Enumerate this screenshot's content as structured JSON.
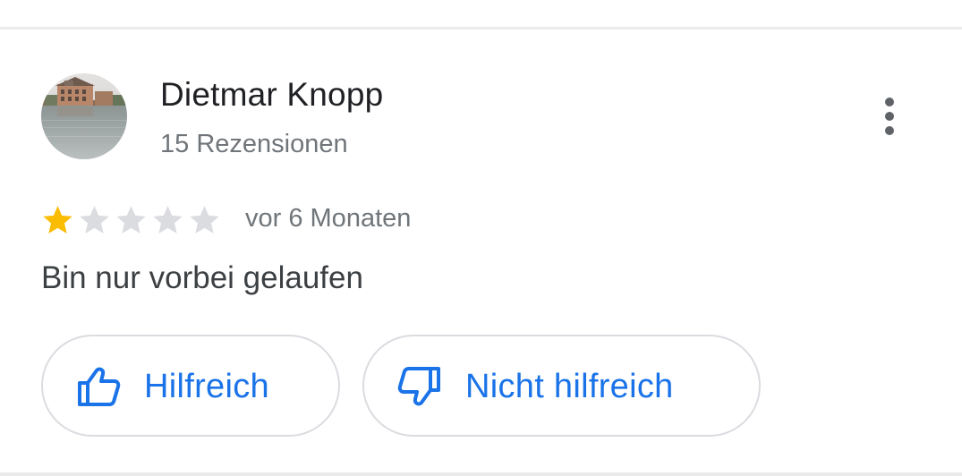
{
  "review": {
    "reviewer_name": "Dietmar Knopp",
    "review_count": "15 Rezensionen",
    "rating": 1,
    "max_rating": 5,
    "time_ago": "vor 6 Monaten",
    "text": "Bin nur vorbei gelaufen"
  },
  "actions": {
    "helpful_label": "Hilfreich",
    "helpful_icon": "thumb-up-icon",
    "not_helpful_label": "Nicht hilfreich",
    "not_helpful_icon": "thumb-down-icon",
    "more_icon": "more-vert-icon"
  },
  "colors": {
    "star_filled": "#fbbc04",
    "star_empty": "#dadce0",
    "accent": "#1a73e8",
    "name_text": "#202124",
    "secondary_text": "#70757a"
  }
}
